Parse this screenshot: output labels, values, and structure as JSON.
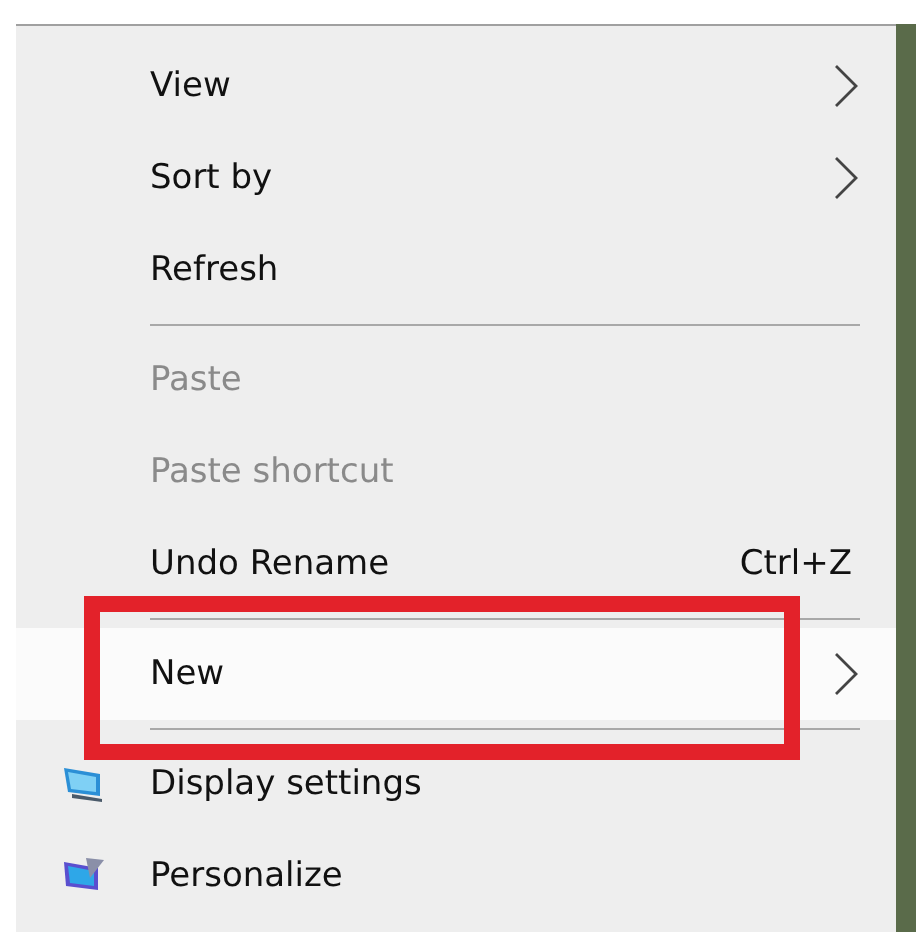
{
  "context_menu": {
    "items": [
      {
        "kind": "item",
        "label": "View",
        "submenu": true,
        "disabled": false,
        "selected": false
      },
      {
        "kind": "item",
        "label": "Sort by",
        "submenu": true,
        "disabled": false,
        "selected": false
      },
      {
        "kind": "item",
        "label": "Refresh",
        "submenu": false,
        "disabled": false,
        "selected": false
      },
      {
        "kind": "separator"
      },
      {
        "kind": "item",
        "label": "Paste",
        "submenu": false,
        "disabled": true,
        "selected": false
      },
      {
        "kind": "item",
        "label": "Paste shortcut",
        "submenu": false,
        "disabled": true,
        "selected": false
      },
      {
        "kind": "item",
        "label": "Undo Rename",
        "shortcut": "Ctrl+Z",
        "submenu": false,
        "disabled": false,
        "selected": false
      },
      {
        "kind": "separator"
      },
      {
        "kind": "item",
        "label": "New",
        "submenu": true,
        "disabled": false,
        "selected": true,
        "highlighted": true
      },
      {
        "kind": "separator"
      },
      {
        "kind": "display",
        "label": "Display settings",
        "submenu": false,
        "disabled": false,
        "selected": false
      },
      {
        "kind": "personalize",
        "label": "Personalize",
        "submenu": false,
        "disabled": false,
        "selected": false
      }
    ]
  }
}
